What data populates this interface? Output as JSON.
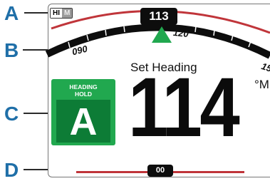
{
  "callouts": [
    "A",
    "B",
    "C",
    "D"
  ],
  "hi_m": {
    "hi": "HI",
    "m": "M"
  },
  "compass": {
    "current_heading": "113",
    "tick_labels": {
      "left": "090",
      "right": "120",
      "far_right": "15"
    },
    "indicator_color": "#21a84f"
  },
  "set_heading": {
    "label": "Set Heading",
    "value": "114",
    "unit": "°M"
  },
  "mode": {
    "title_line1": "HEADING",
    "title_line2": "HOLD",
    "letter": "A",
    "color": "#21a84f",
    "inner_color": "#0d7c36"
  },
  "rudder": {
    "value": "00",
    "bar_color": "#c0353a"
  },
  "colors": {
    "callout": "#1f6fa8",
    "arc_red": "#c0353a",
    "arc_black": "#0d0d0d"
  }
}
